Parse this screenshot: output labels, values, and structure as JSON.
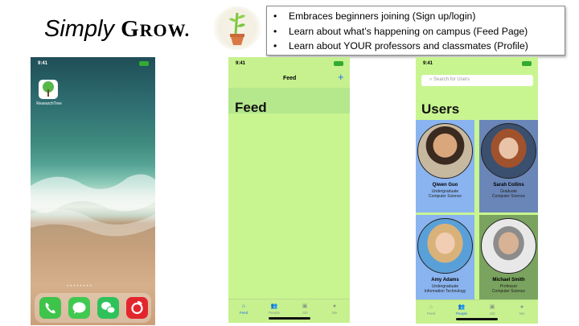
{
  "slide": {
    "title_simply": "Simply",
    "title_g": "G",
    "title_row": "ROW.",
    "bullets": [
      "Embraces beginners joining (Sign up/login)",
      "Learn about what’s happening on campus (Feed Page)",
      "Learn about YOUR professors and classmates (Profile)"
    ]
  },
  "phone_home": {
    "time": "9:41",
    "app_label": "ResearchTree",
    "dock_apps": [
      "phone-app",
      "messages-app",
      "wechat-app",
      "netease-music-app"
    ],
    "colors": {
      "phone": "#3ec44a",
      "messages": "#40c950",
      "wechat": "#2fc25b",
      "music": "#e3262d"
    }
  },
  "phone_feed": {
    "time": "9:41",
    "nav_title": "Feed",
    "add_icon": "+",
    "big_title": "Feed",
    "tabs": [
      {
        "label": "Feed",
        "icon": "home-icon",
        "active": true
      },
      {
        "label": "People",
        "icon": "people-icon",
        "active": false
      },
      {
        "label": "Job",
        "icon": "briefcase-icon",
        "active": false
      },
      {
        "label": "Me",
        "icon": "person-icon",
        "active": false
      }
    ],
    "colors": {
      "background": "#c8f590",
      "header": "#b5e78c",
      "accent": "#1a73e8"
    }
  },
  "phone_users": {
    "time": "9:41",
    "search_placeholder": "Search for Users",
    "title": "Users",
    "users": [
      {
        "name": "Qiwen  Guo",
        "role": "Undergraduate",
        "dept": "Computer Science",
        "card_color": "#8ab4f0"
      },
      {
        "name": "Sarah Collins",
        "role": "Graduate",
        "dept": "Computer Science",
        "card_color": "#6a86b8"
      },
      {
        "name": "Amy Adams",
        "role": "Undergraduate",
        "dept": "Information Technology",
        "card_color": "#8ab4f0"
      },
      {
        "name": "Michael Smith",
        "role": "Professor",
        "dept": "Computer Science",
        "card_color": "#7aa35f"
      }
    ],
    "tabs": [
      {
        "label": "Feed",
        "icon": "home-icon",
        "active": false
      },
      {
        "label": "People",
        "icon": "people-icon",
        "active": true
      },
      {
        "label": "Job",
        "icon": "briefcase-icon",
        "active": false
      },
      {
        "label": "Me",
        "icon": "person-icon",
        "active": false
      }
    ]
  }
}
